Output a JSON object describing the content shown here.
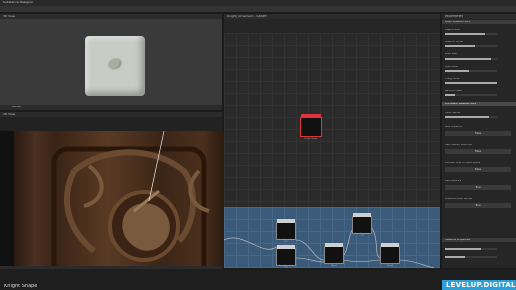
{
  "app": {
    "title": "Substance Designer"
  },
  "view3d": {
    "title": "3D View",
    "footer": "Default"
  },
  "view2d": {
    "title": "2D View"
  },
  "graph": {
    "title": "Knight_Ornament - GRAPH",
    "nodes": [
      {
        "label": "Knight Shape"
      },
      {
        "label": "Transformation 2D"
      },
      {
        "label": "Transformation 2D"
      },
      {
        "label": "Blend"
      },
      {
        "label": "Transformation 2D"
      },
      {
        "label": "Blend"
      },
      {
        "label": "Blend"
      }
    ]
  },
  "props": {
    "title": "PROPERTIES",
    "sections": [
      "BASE PARAMETERS",
      "DISTANCE PARAMETERS",
      "Instance Properties"
    ],
    "labels": [
      "Output Size",
      "Output Format",
      "Pixel Size",
      "Pixel Ratio",
      "Tiling Mode",
      "Random Seed",
      "Input Spline",
      "Max Distance",
      "Use Custom Pixel List",
      "Connect One to Input Spline",
      "Use Distance",
      "Preserve Input Border"
    ],
    "buttons": [
      "False",
      "False",
      "False",
      "True",
      "True"
    ]
  },
  "status": {
    "caption": "Knight Shape",
    "brand": "LEVELUP.DIGITAL"
  }
}
